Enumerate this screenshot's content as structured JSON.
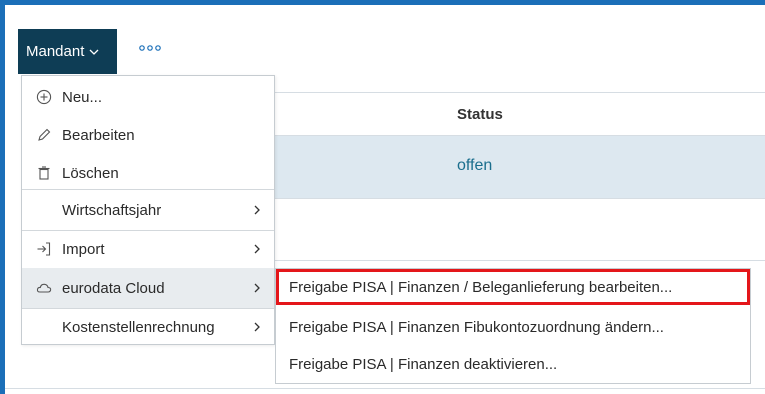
{
  "toolbar": {
    "mandant_label": "Mandant",
    "more_icon": "more-dots-icon"
  },
  "table": {
    "column_status": "Status",
    "row_status": "offen"
  },
  "menu": {
    "items": [
      {
        "label": "Neu...",
        "icon": "plus-circle-icon",
        "submenu": false
      },
      {
        "label": "Bearbeiten",
        "icon": "pencil-icon",
        "submenu": false
      },
      {
        "label": "Löschen",
        "icon": "trash-icon",
        "submenu": false
      },
      {
        "label": "Wirtschaftsjahr",
        "icon": "",
        "submenu": true
      },
      {
        "label": "Import",
        "icon": "import-icon",
        "submenu": true
      },
      {
        "label": "eurodata Cloud",
        "icon": "cloud-icon",
        "submenu": true,
        "selected": true
      },
      {
        "label": "Kostenstellenrechnung",
        "icon": "",
        "submenu": true
      }
    ]
  },
  "submenu": {
    "items": [
      {
        "label": "Freigabe PISA | Finanzen / Beleganlieferung bearbeiten...",
        "highlighted": true
      },
      {
        "label": "Freigabe PISA | Finanzen Fibukontozuordnung ändern..."
      },
      {
        "label": "Freigabe PISA | Finanzen deaktivieren..."
      }
    ]
  },
  "colors": {
    "frame_border": "#1b6fb8",
    "mandant_bg": "#0e3d55",
    "highlight_box": "#e4161a",
    "status_text": "#1a6e8d",
    "row_highlight": "#dde8f0"
  }
}
